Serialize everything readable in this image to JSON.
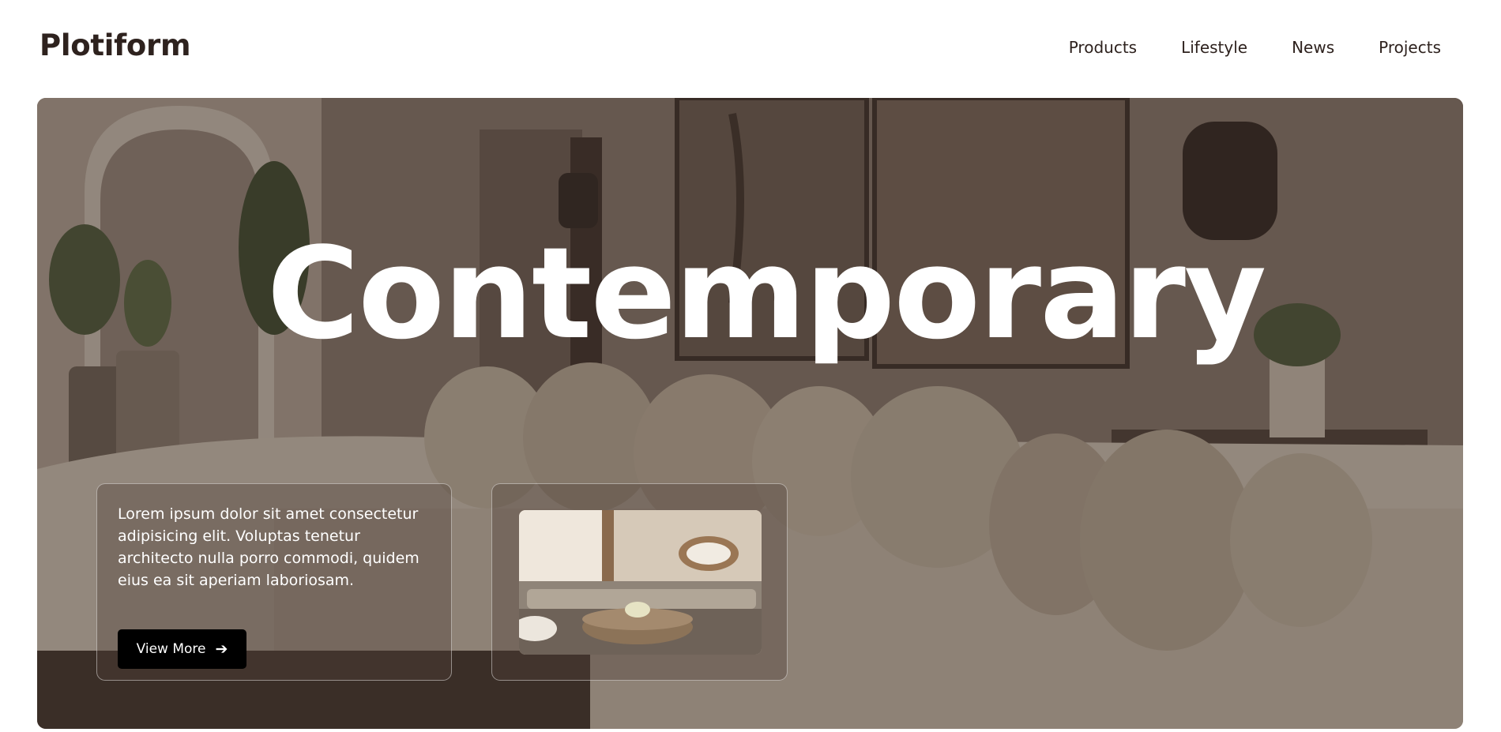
{
  "header": {
    "brand": "Plotiform",
    "nav": [
      "Products",
      "Lifestyle",
      "News",
      "Projects"
    ]
  },
  "hero": {
    "title": "Contemporary",
    "image": "living-room-photo"
  },
  "cards": {
    "text": "Lorem ipsum dolor sit amet consectetur adipisicing elit. Voluptas tenetur architecto nulla porro commodi, quidem eius ea sit aperiam laboriosam.",
    "button_label": "View More",
    "button_icon": "arrow-right-icon",
    "thumbnail": "living-room-thumbnail"
  },
  "colors": {
    "brand_text": "#2e221e",
    "button_bg": "#000000",
    "title": "#ffffff"
  }
}
